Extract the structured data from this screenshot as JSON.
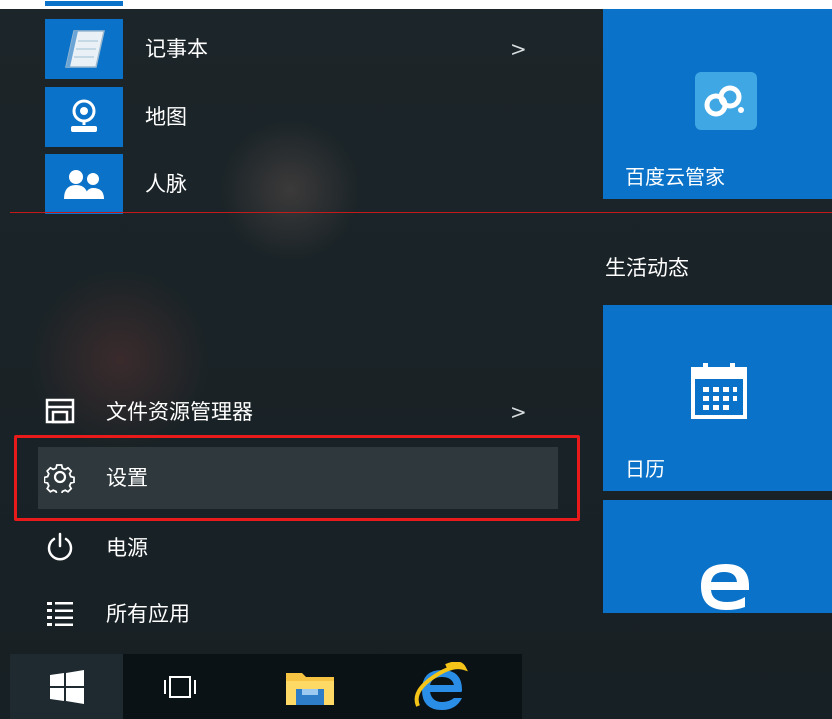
{
  "apps": [
    {
      "name": "记事本",
      "has_submenu": true,
      "icon": "notepad-icon"
    },
    {
      "name": "地图",
      "has_submenu": false,
      "icon": "maps-icon"
    },
    {
      "name": "人脉",
      "has_submenu": false,
      "icon": "people-icon"
    }
  ],
  "system": {
    "file_explorer": "文件资源管理器",
    "settings": "设置",
    "power": "电源",
    "all_apps": "所有应用",
    "submenu_glyph": ">"
  },
  "tiles": {
    "baidu_cloud": "百度云管家",
    "group_title": "生活动态",
    "calendar": "日历"
  },
  "taskbar": {
    "items": [
      "start-button",
      "task-view-button",
      "file-explorer-button",
      "internet-explorer-button"
    ]
  },
  "colors": {
    "tile_blue": "#0a72c8",
    "highlight_red": "#e81a1a",
    "divider_red": "#c41a1a",
    "settings_bg": "#2f393d"
  }
}
